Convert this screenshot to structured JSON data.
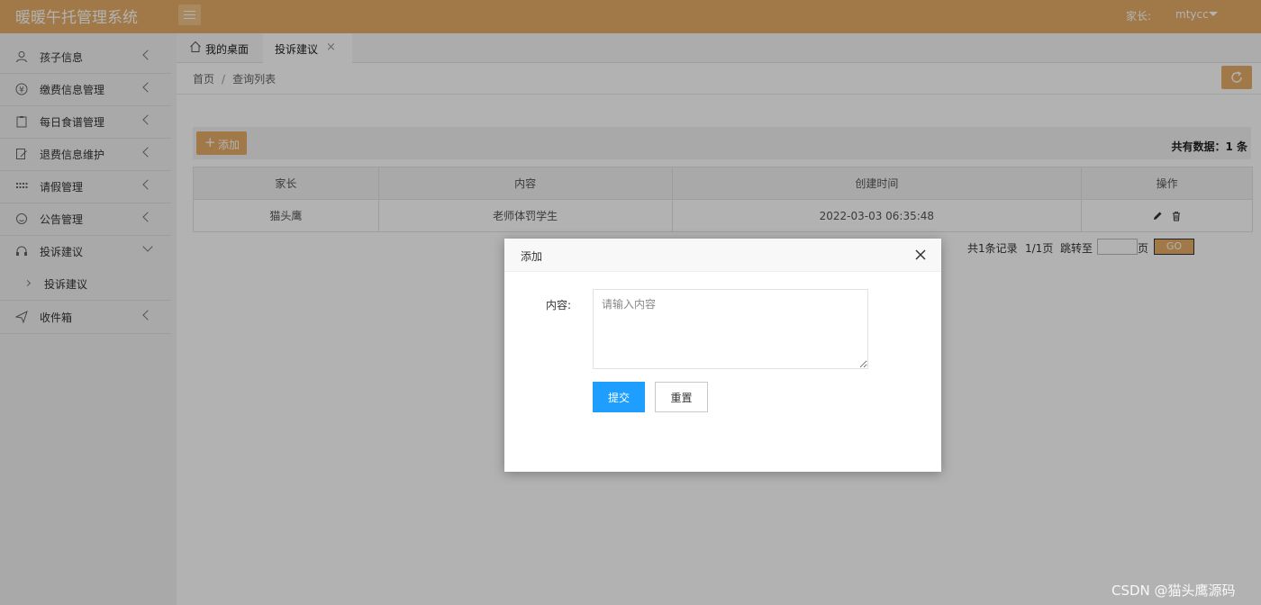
{
  "app": {
    "title": "暖暖午托管理系统"
  },
  "header": {
    "user_label": "家长:",
    "user_name": "mtycc"
  },
  "sidebar": {
    "items": [
      {
        "label": "孩子信息",
        "icon": "user-icon"
      },
      {
        "label": "缴费信息管理",
        "icon": "yen-icon"
      },
      {
        "label": "每日食谱管理",
        "icon": "clipboard-icon"
      },
      {
        "label": "退费信息维护",
        "icon": "edit-note-icon"
      },
      {
        "label": "请假管理",
        "icon": "calendar-icon"
      },
      {
        "label": "公告管理",
        "icon": "circle-icon"
      },
      {
        "label": "投诉建议",
        "icon": "headset-icon",
        "expanded": true
      },
      {
        "label": "收件箱",
        "icon": "send-icon"
      }
    ],
    "sub_items": [
      {
        "label": "投诉建议"
      }
    ]
  },
  "tabs": [
    {
      "label": "我的桌面",
      "icon": "home-icon"
    },
    {
      "label": "投诉建议",
      "active": true
    }
  ],
  "breadcrumb": {
    "home": "首页",
    "current": "查询列表",
    "separator": "/"
  },
  "toolbar": {
    "add_label": "添加",
    "total_text": "共有数据：1 条"
  },
  "table": {
    "columns": [
      "家长",
      "内容",
      "创建时间",
      "操作"
    ],
    "rows": [
      {
        "parent": "猫头鹰",
        "content": "老师体罚学生",
        "created": "2022-03-03 06:35:48"
      }
    ]
  },
  "pager": {
    "records": "共1条记录",
    "pages": "1/1页",
    "jump_label": "跳转至",
    "page_unit": "页",
    "go_label": "GO"
  },
  "modal": {
    "title": "添加",
    "content_label": "内容:",
    "content_placeholder": "请输入内容",
    "submit_label": "提交",
    "reset_label": "重置"
  },
  "watermark": "CSDN @猫头鹰源码",
  "colors": {
    "primary": "#e7ae67",
    "submit": "#1e9fff",
    "sidebar_bg": "#f2f2f2"
  }
}
